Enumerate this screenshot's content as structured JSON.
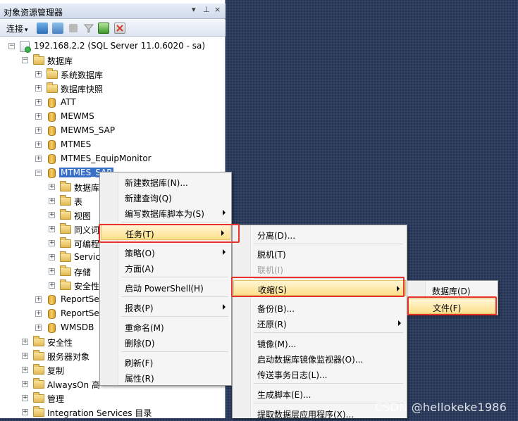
{
  "panel": {
    "title": "对象资源管理器",
    "controls": [
      "▾",
      "⊥",
      "×"
    ]
  },
  "toolbar": {
    "connect_label": "连接",
    "connect_arrow": "▾"
  },
  "tree": [
    {
      "label": "192.168.2.2 (SQL Server 11.0.6020 - sa)",
      "expander": "−"
    },
    {
      "label": "数据库",
      "expander": "−"
    },
    {
      "label": "系统数据库",
      "expander": "+"
    },
    {
      "label": "数据库快照",
      "expander": "+"
    },
    {
      "label": "ATT",
      "expander": "+"
    },
    {
      "label": "MEWMS",
      "expander": "+"
    },
    {
      "label": "MEWMS_SAP",
      "expander": "+"
    },
    {
      "label": "MTMES",
      "expander": "+"
    },
    {
      "label": "MTMES_EquipMonitor",
      "expander": "+"
    },
    {
      "label": "MTMES_SAP",
      "expander": "−"
    },
    {
      "label": "数据库",
      "expander": "+"
    },
    {
      "label": "表",
      "expander": "+"
    },
    {
      "label": "视图",
      "expander": "+"
    },
    {
      "label": "同义词",
      "expander": "+"
    },
    {
      "label": "可编程",
      "expander": "+"
    },
    {
      "label": "Service",
      "expander": "+"
    },
    {
      "label": "存储",
      "expander": "+"
    },
    {
      "label": "安全性",
      "expander": "+"
    },
    {
      "label": "ReportSe",
      "expander": "+"
    },
    {
      "label": "ReportSe",
      "expander": "+"
    },
    {
      "label": "WMSDB",
      "expander": "+"
    },
    {
      "label": "安全性",
      "expander": "+"
    },
    {
      "label": "服务器对象",
      "expander": "+"
    },
    {
      "label": "复制",
      "expander": "+"
    },
    {
      "label": "AlwaysOn 高",
      "expander": "+"
    },
    {
      "label": "管理",
      "expander": "+"
    },
    {
      "label": "Integration Services 目录",
      "expander": "+"
    }
  ],
  "menu1": [
    {
      "label": "新建数据库(N)..."
    },
    {
      "label": "新建查询(Q)"
    },
    {
      "label": "编写数据库脚本为(S)"
    },
    {
      "label": "任务(T)"
    },
    {
      "label": "策略(O)"
    },
    {
      "label": "方面(A)"
    },
    {
      "label": "启动 PowerShell(H)"
    },
    {
      "label": "报表(P)"
    },
    {
      "label": "重命名(M)"
    },
    {
      "label": "删除(D)"
    },
    {
      "label": "刷新(F)"
    },
    {
      "label": "属性(R)"
    }
  ],
  "menu2": [
    {
      "label": "分离(D)..."
    },
    {
      "label": "脱机(T)"
    },
    {
      "label": "联机(I)"
    },
    {
      "label": "收缩(S)"
    },
    {
      "label": "备份(B)..."
    },
    {
      "label": "还原(R)"
    },
    {
      "label": "镜像(M)..."
    },
    {
      "label": "启动数据库镜像监视器(O)..."
    },
    {
      "label": "传送事务日志(L)..."
    },
    {
      "label": "生成脚本(E)..."
    },
    {
      "label": "提取数据层应用程序(X)..."
    }
  ],
  "menu3": [
    {
      "label": "数据库(D)"
    },
    {
      "label": "文件(F)"
    }
  ],
  "watermark": "CSDN @hellokeke1986",
  "colors": {
    "highlight_border": "#e8332d",
    "selection": "#3a6fc8",
    "desktop": "#2b3c5e"
  }
}
